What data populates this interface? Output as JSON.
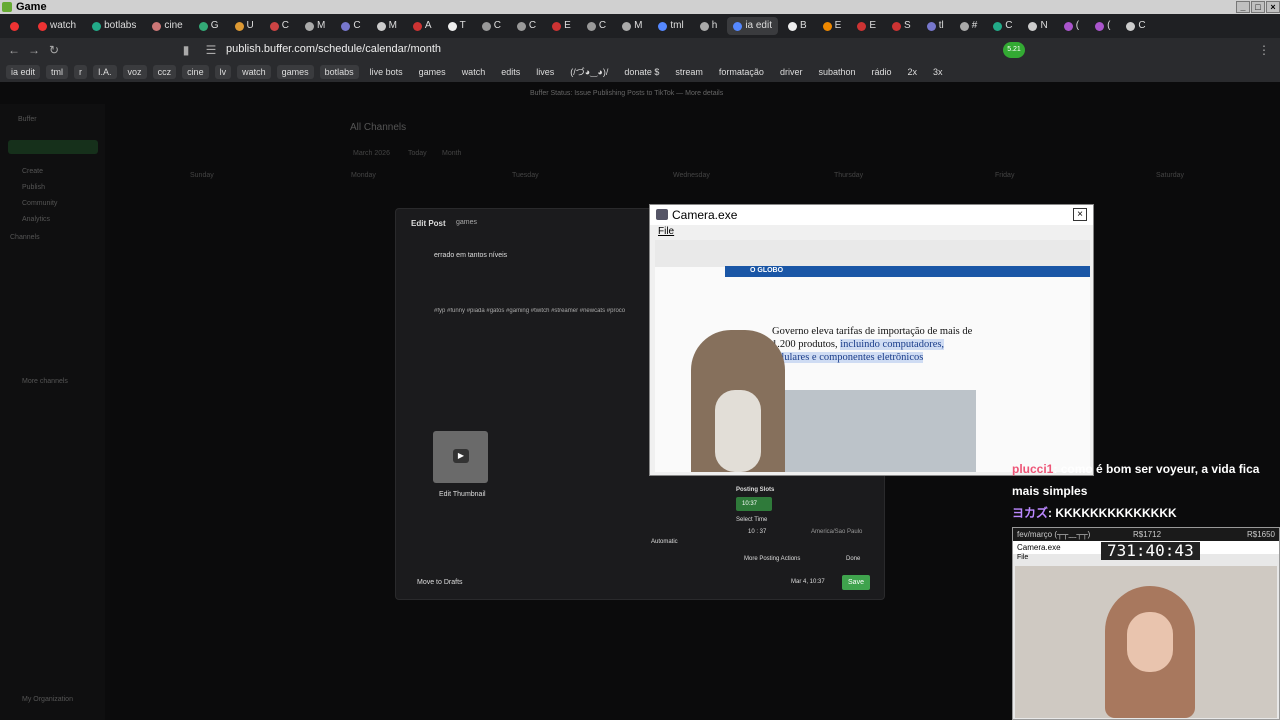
{
  "os": {
    "title": "Game"
  },
  "tabs": [
    {
      "label": "",
      "color": "#e33"
    },
    {
      "label": "watch",
      "color": "#e33"
    },
    {
      "label": "botlabs",
      "color": "#2a8"
    },
    {
      "label": "cine",
      "color": "#c77"
    },
    {
      "label": "G",
      "color": "#3a7"
    },
    {
      "label": "U",
      "color": "#d93"
    },
    {
      "label": "C",
      "color": "#c44"
    },
    {
      "label": "M",
      "color": "#aaa"
    },
    {
      "label": "C",
      "color": "#77c"
    },
    {
      "label": "M",
      "color": "#ccc"
    },
    {
      "label": "A",
      "color": "#c33"
    },
    {
      "label": "T",
      "color": "#eee"
    },
    {
      "label": "C",
      "color": "#999"
    },
    {
      "label": "C",
      "color": "#999"
    },
    {
      "label": "E",
      "color": "#c33"
    },
    {
      "label": "C",
      "color": "#999"
    },
    {
      "label": "M",
      "color": "#aaa"
    },
    {
      "label": "tml",
      "color": "#58f"
    },
    {
      "label": "h",
      "color": "#aaa"
    },
    {
      "label": "ia edit",
      "color": "#58f"
    },
    {
      "label": "B",
      "color": "#eee"
    },
    {
      "label": "E",
      "color": "#e80"
    },
    {
      "label": "E",
      "color": "#c33"
    },
    {
      "label": "S",
      "color": "#c33"
    },
    {
      "label": "tl",
      "color": "#77c"
    },
    {
      "label": "#",
      "color": "#aaa"
    },
    {
      "label": "C",
      "color": "#2a8"
    },
    {
      "label": "N",
      "color": "#ccc"
    },
    {
      "label": "(",
      "color": "#a5c"
    },
    {
      "label": "(",
      "color": "#a5c"
    },
    {
      "label": "C",
      "color": "#ccc"
    }
  ],
  "address": {
    "url": "publish.buffer.com/schedule/calendar/month"
  },
  "bookmarks": [
    {
      "label": "ia edit",
      "color": "#3a3b3e"
    },
    {
      "label": "tml",
      "color": "#3a3b3e"
    },
    {
      "label": "r",
      "color": "#3a3b3e"
    },
    {
      "label": "I.A.",
      "color": "#3a3b3e"
    },
    {
      "label": "voz",
      "color": "#3a3b3e"
    },
    {
      "label": "ccz",
      "color": "#3a3b3e"
    },
    {
      "label": "cine",
      "color": "#3a3b3e"
    },
    {
      "label": "lv",
      "color": "#3a3b3e"
    },
    {
      "label": "watch",
      "color": "#3a3b3e"
    },
    {
      "label": "games",
      "color": "#3a3b3e"
    },
    {
      "label": "botlabs",
      "color": "#3a3b3e"
    },
    {
      "label": "live bots",
      "color": "transparent"
    },
    {
      "label": "games",
      "color": "transparent"
    },
    {
      "label": "watch",
      "color": "transparent"
    },
    {
      "label": "edits",
      "color": "transparent"
    },
    {
      "label": "lives",
      "color": "transparent"
    },
    {
      "label": "(/づ◕‿◕)/",
      "color": "transparent"
    },
    {
      "label": "donate $",
      "color": "transparent"
    },
    {
      "label": "stream",
      "color": "transparent"
    },
    {
      "label": "formatação",
      "color": "transparent"
    },
    {
      "label": "driver",
      "color": "transparent"
    },
    {
      "label": "subathon",
      "color": "transparent"
    },
    {
      "label": "rádio",
      "color": "transparent"
    },
    {
      "label": "2x",
      "color": "transparent"
    },
    {
      "label": "3x",
      "color": "transparent"
    }
  ],
  "buffer": {
    "banner": "Buffer Status: Issue Publishing Posts to TikTok — More details",
    "sidebar": {
      "brand": "Buffer",
      "create": "Create",
      "publish": "Publish",
      "community": "Community",
      "analytics": "Analytics",
      "channels": "Channels",
      "more": "More channels",
      "org": "My Organization"
    },
    "calendar": {
      "title": "All Channels",
      "month": "March 2026",
      "today": "Today",
      "view": "Month",
      "days": [
        "Sunday",
        "Monday",
        "Tuesday",
        "Wednesday",
        "Thursday",
        "Friday",
        "Saturday"
      ]
    },
    "modal": {
      "title": "Edit Post",
      "channel": "games",
      "post_title": "errado em tantos níveis",
      "hashtags": "#fyp #funny #piada #gatos #gaming #twitch #streamer #newcats #proco",
      "edit_thumbnail": "Edit Thumbnail",
      "automatic": "Automatic",
      "posting_slots": "Posting Slots",
      "slot_time": "10:37",
      "select_time": "Select Time",
      "time_value": "10 : 37",
      "timezone": "America/Sao Paulo",
      "more_actions": "More Posting Actions",
      "done": "Done",
      "move_drafts": "Move to Drafts",
      "date": "Mar 4, 10:37",
      "save": "Save"
    }
  },
  "camera": {
    "title": "Camera.exe",
    "menu": "File",
    "headline_a": "Governo eleva tarifas de importação de mais de 1.200 produtos, ",
    "headline_b": "incluindo computadores, celulares e componentes eletrônicos",
    "site": "O GLOBO"
  },
  "chat": [
    {
      "name": "plucci1",
      "text": ": como é bom ser voyeur, a vida fica mais simples"
    },
    {
      "name": "ヨカズ",
      "text": ": KKKKKKKKKKKKKK"
    }
  ],
  "stream": {
    "bar_left": "fev/março (┬┬﹏┬┬)",
    "bar_mid": "R$1712",
    "bar_right": "R$1650",
    "cam_title": "Camera.exe",
    "menu": "File",
    "timer": "731:40:43"
  }
}
